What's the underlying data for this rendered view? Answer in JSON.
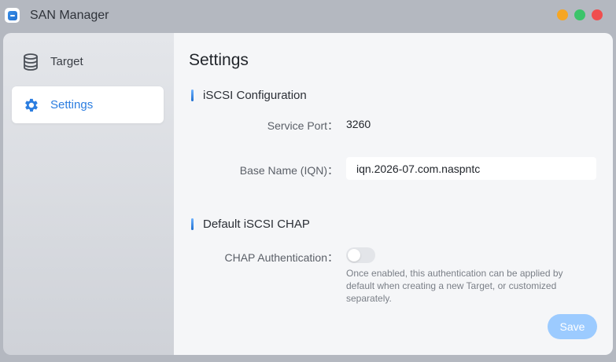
{
  "window": {
    "title": "SAN Manager",
    "controls": [
      "minimize",
      "maximize",
      "close"
    ]
  },
  "sidebar": {
    "items": [
      {
        "label": "Target",
        "icon": "database-icon",
        "active": false
      },
      {
        "label": "Settings",
        "icon": "gear-icon",
        "active": true
      }
    ]
  },
  "main": {
    "title": "Settings",
    "iscsi": {
      "section_title": "iSCSI Configuration",
      "service_port_label": "Service Port：",
      "service_port_value": "3260",
      "base_name_label": "Base Name (IQN)：",
      "base_name_value": "iqn.2026-07.com.naspntc"
    },
    "chap": {
      "section_title": "Default iSCSI CHAP",
      "auth_label": "CHAP Authentication：",
      "auth_enabled": false,
      "help_text": "Once enabled, this authentication can be applied by default when creating a new Target, or customized separately."
    },
    "save_label": "Save"
  },
  "colors": {
    "accent": "#2b7de0",
    "save_disabled": "#9ccbff",
    "minimize": "#f6a623",
    "maximize": "#3cc46a",
    "close": "#f04e4e"
  }
}
